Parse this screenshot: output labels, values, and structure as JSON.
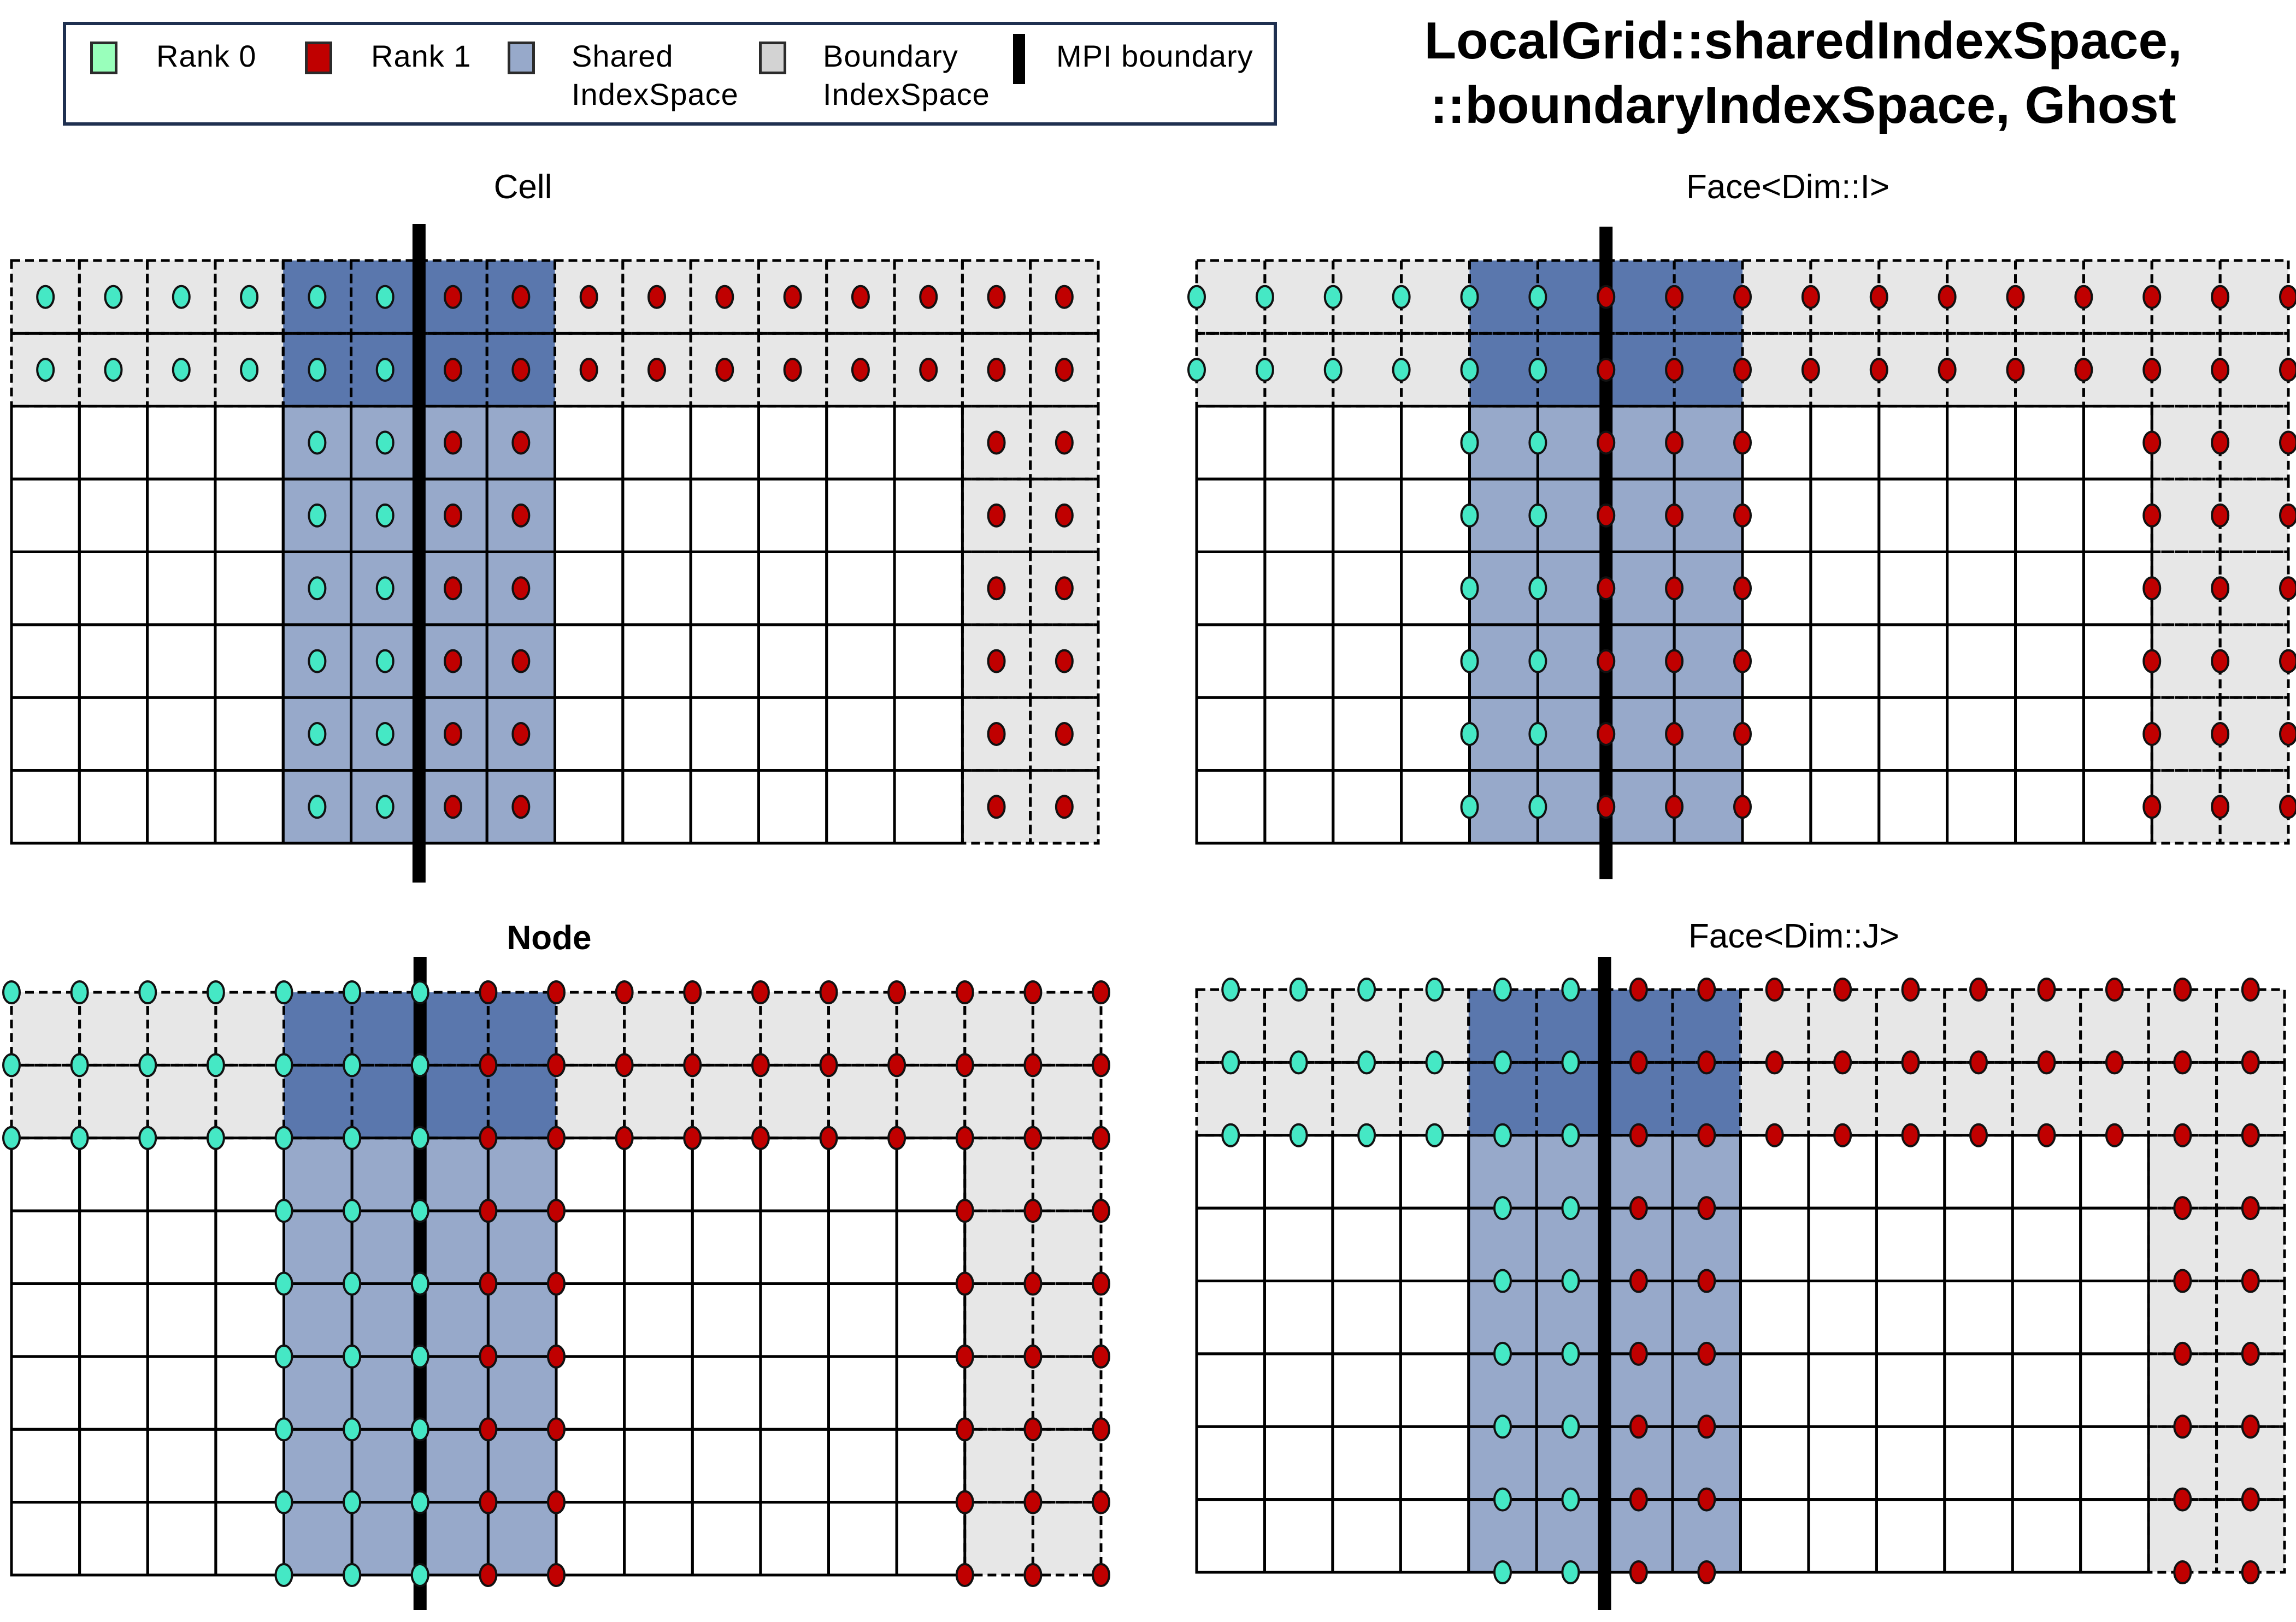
{
  "title": {
    "line1": "LocalGrid::sharedIndexSpace,",
    "line2": "::boundaryIndexSpace, Ghost"
  },
  "legend": {
    "items": [
      {
        "label": "Rank 0",
        "label2": "",
        "color": "#99ffbb",
        "type": "swatch"
      },
      {
        "label": "Rank 1",
        "label2": "",
        "color": "#c00000",
        "type": "swatch"
      },
      {
        "label": "Shared",
        "label2": "IndexSpace",
        "color": "#97a9ca",
        "type": "swatch"
      },
      {
        "label": "Boundary",
        "label2": "IndexSpace",
        "color": "#d3d3d3",
        "type": "swatch"
      },
      {
        "label": "MPI boundary",
        "label2": "",
        "color": "#000000",
        "type": "line"
      }
    ]
  },
  "colors": {
    "rank0_point": "#45e8c5",
    "rank1_point": "#c00000",
    "shared_ghost": "#5a77ad",
    "shared_owned": "#97a9ca",
    "boundary": "#e7e7e7",
    "grid_line": "#000000",
    "mpi_boundary": "#000000"
  },
  "grid": {
    "columns": 16,
    "rows": 8,
    "ghost_rows": [
      0,
      1
    ],
    "boundary_columns": [
      14,
      15
    ],
    "shared_columns": [
      4,
      5,
      6,
      7
    ],
    "mpi_boundary_column_line": 6
  },
  "panels": [
    {
      "name": "cell",
      "title": "Cell",
      "entity": "cell",
      "point_groups": [
        {
          "rows": [
            0,
            1
          ],
          "cols_rank0": [
            0,
            1,
            2,
            3,
            4,
            5
          ],
          "cols_rank1": [
            6,
            7,
            8,
            9,
            10,
            11,
            12,
            13,
            14,
            15
          ]
        },
        {
          "rows": [
            2,
            3,
            4,
            5,
            6,
            7
          ],
          "cols_rank0": [
            4,
            5
          ],
          "cols_rank1": [
            6,
            7,
            14,
            15
          ]
        }
      ]
    },
    {
      "name": "face-i",
      "title": "Face<Dim::I>",
      "entity": "face_i",
      "point_groups": [
        {
          "rows": [
            0,
            1
          ],
          "cols_rank0": [
            0,
            1,
            2,
            3,
            4,
            5
          ],
          "cols_rank1": [
            6,
            7,
            8,
            9,
            10,
            11,
            12,
            13,
            14,
            15,
            16
          ]
        },
        {
          "rows": [
            2,
            3,
            4,
            5,
            6,
            7
          ],
          "cols_rank0": [
            4,
            5
          ],
          "cols_rank1": [
            6,
            7,
            8,
            14,
            15,
            16
          ]
        }
      ]
    },
    {
      "name": "node",
      "title": "Node",
      "entity": "node",
      "point_groups": [
        {
          "rows": [
            0,
            1,
            2
          ],
          "cols_rank0": [
            0,
            1,
            2,
            3,
            4,
            5,
            6
          ],
          "cols_rank1": [
            7,
            8,
            9,
            10,
            11,
            12,
            13,
            14,
            15,
            16
          ]
        },
        {
          "rows": [
            3,
            4,
            5,
            6,
            7,
            8
          ],
          "cols_rank0": [
            4,
            5,
            6
          ],
          "cols_rank1": [
            7,
            8,
            14,
            15,
            16
          ]
        }
      ]
    },
    {
      "name": "face-j",
      "title": "Face<Dim::J>",
      "entity": "face_j",
      "point_groups": [
        {
          "rows": [
            0,
            1,
            2
          ],
          "cols_rank0": [
            0,
            1,
            2,
            3,
            4,
            5
          ],
          "cols_rank1": [
            6,
            7,
            8,
            9,
            10,
            11,
            12,
            13,
            14,
            15
          ]
        },
        {
          "rows": [
            3,
            4,
            5,
            6,
            7,
            8
          ],
          "cols_rank0": [
            4,
            5
          ],
          "cols_rank1": [
            6,
            7,
            14,
            15
          ]
        }
      ]
    }
  ]
}
